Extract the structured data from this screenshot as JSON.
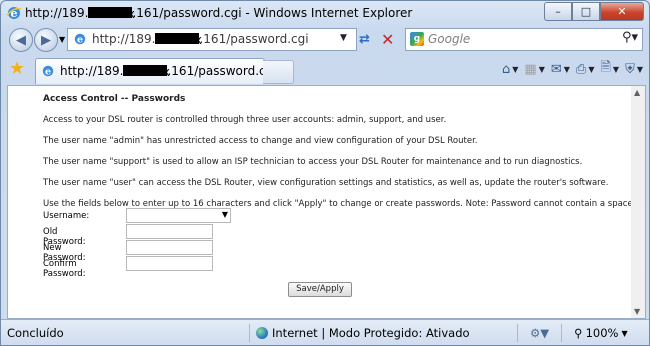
{
  "window": {
    "title_prefix": "http://189.",
    "title_redacted": "xxx.xxx",
    "title_suffix": ".161/password.cgi - Windows Internet Explorer",
    "min_label": "–",
    "max_label": "□",
    "close_label": "✕"
  },
  "address_bar": {
    "url_prefix": "http://189.",
    "url_redacted": "xxx.xxx",
    "url_suffix": ".161/password.cgi"
  },
  "search": {
    "placeholder": "Google"
  },
  "tab": {
    "url_prefix": "http://189.",
    "url_redacted": "xxx.xxx",
    "url_suffix": ".161/password.cgi"
  },
  "page": {
    "heading": "Access Control -- Passwords",
    "paragraphs": [
      "Access to your DSL router is controlled through three user accounts: admin, support, and user.",
      "The user name \"admin\" has unrestricted access to change and view configuration of your DSL Router.",
      "The user name \"support\" is used to allow an ISP technician to access your DSL Router for maintenance and to run diagnostics.",
      "The user name \"user\" can access the DSL Router, view configuration settings and statistics, as well as, update the router's software.",
      "Use the fields below to enter up to 16 characters and click \"Apply\" to change or create passwords. Note: Password cannot contain a space."
    ],
    "form": {
      "username_label": "Username:",
      "username_value": "",
      "old_password_label": "Old Password:",
      "new_password_label": "New Password:",
      "confirm_password_label": "Confirm Password:"
    },
    "apply_label": "Save/Apply"
  },
  "status_bar": {
    "left_text": "Concluído",
    "zone_text": "Internet | Modo Protegido: Ativado",
    "zoom_text": "100%"
  }
}
